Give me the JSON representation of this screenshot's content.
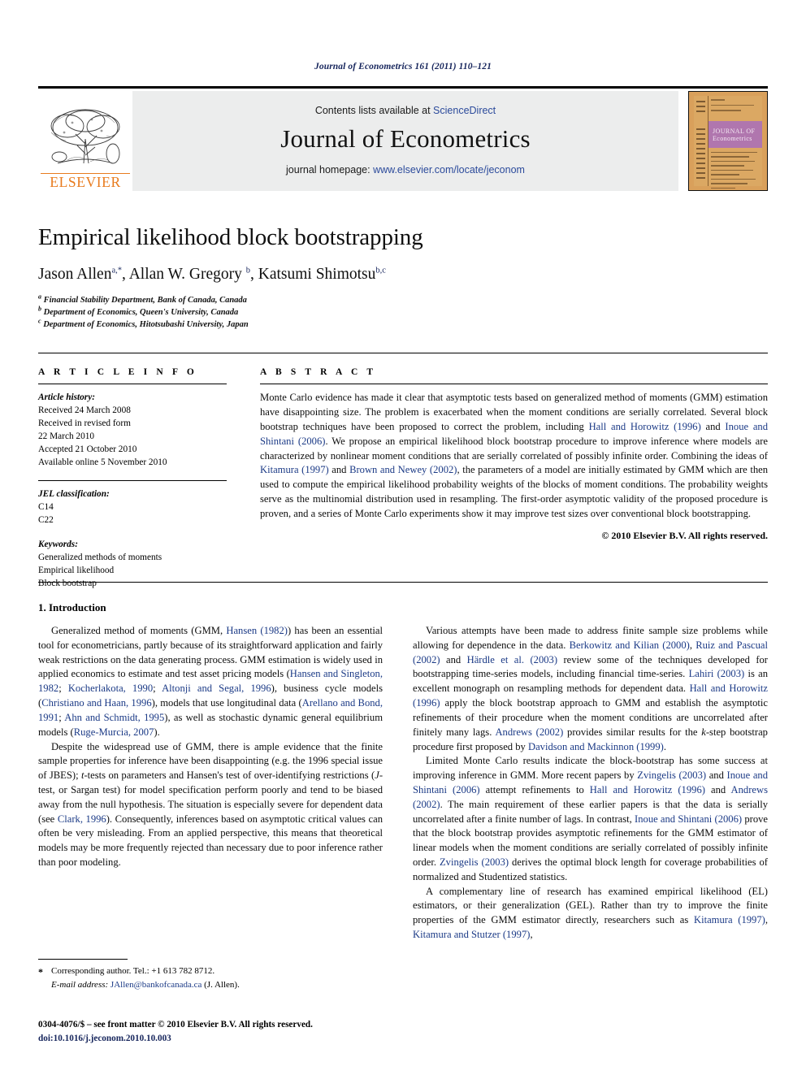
{
  "running_head": "Journal of Econometrics 161 (2011) 110–121",
  "masthead": {
    "publisher_name": "ELSEVIER",
    "contents_prefix": "Contents lists available at ",
    "contents_link": "ScienceDirect",
    "journal_title": "Journal of Econometrics",
    "homepage_prefix": "journal homepage: ",
    "homepage_link": "www.elsevier.com/locate/jeconom",
    "cover_title_line1": "JOURNAL OF",
    "cover_title_line2": "Econometrics",
    "link_color": "#2b4a9b",
    "brand_color": "#e87b1e"
  },
  "article": {
    "title": "Empirical likelihood block bootstrapping",
    "authors_html": "Jason Allen<sup>a,*</sup>, Allan W. Gregory <sup>b</sup>, Katsumi Shimotsu<sup>b,c</sup>",
    "affiliations": [
      {
        "marker": "a",
        "text": "Financial Stability Department, Bank of Canada, Canada"
      },
      {
        "marker": "b",
        "text": "Department of Economics, Queen's University, Canada"
      },
      {
        "marker": "c",
        "text": "Department of Economics, Hitotsubashi University, Japan"
      }
    ]
  },
  "article_info": {
    "label": "A R T I C L E   I N F O",
    "history_head": "Article history:",
    "history_lines": [
      "Received 24 March 2008",
      "Received in revised form",
      "22 March 2010",
      "Accepted 21 October 2010",
      "Available online 5 November 2010"
    ],
    "jel_head": "JEL classification:",
    "jel_codes": [
      "C14",
      "C22"
    ],
    "keywords_head": "Keywords:",
    "keywords": [
      "Generalized methods of moments",
      "Empirical likelihood",
      "Block bootstrap"
    ]
  },
  "abstract": {
    "label": "A B S T R A C T",
    "text_html": "Monte Carlo evidence has made it clear that asymptotic tests based on generalized method of moments (GMM) estimation have disappointing size. The problem is exacerbated when the moment conditions are serially correlated. Several block bootstrap techniques have been proposed to correct the problem, including <span class=\"cite\">Hall and Horowitz (1996)</span> and <span class=\"cite\">Inoue and Shintani (2006)</span>. We propose an empirical likelihood block bootstrap procedure to improve inference where models are characterized by nonlinear moment conditions that are serially correlated of possibly infinite order. Combining the ideas of <span class=\"cite\">Kitamura (1997)</span> and <span class=\"cite\">Brown and Newey (2002)</span>, the parameters of a model are initially estimated by GMM which are then used to compute the empirical likelihood probability weights of the blocks of moment conditions. The probability weights serve as the multinomial distribution used in resampling. The first-order asymptotic validity of the proposed procedure is proven, and a series of Monte Carlo experiments show it may improve test sizes over conventional block bootstrapping.",
    "copyright": "© 2010 Elsevier B.V. All rights reserved."
  },
  "body": {
    "section_heading": "1. Introduction",
    "left_paragraphs_html": [
      "Generalized method of moments (GMM, <span class=\"cite\">Hansen (1982)</span>) has been an essential tool for econometricians, partly because of its straightforward application and fairly weak restrictions on the data generating process. GMM estimation is widely used in applied economics to estimate and test asset pricing models (<span class=\"cite\">Hansen and Singleton, 1982</span>; <span class=\"cite\">Kocherlakota, 1990</span>; <span class=\"cite\">Altonji and Segal, 1996</span>), business cycle models (<span class=\"cite\">Christiano and Haan, 1996</span>), models that use longitudinal data (<span class=\"cite\">Arellano and Bond, 1991</span>; <span class=\"cite\">Ahn and Schmidt, 1995</span>), as well as stochastic dynamic general equilibrium models (<span class=\"cite\">Ruge-Murcia, 2007</span>).",
      "Despite the widespread use of GMM, there is ample evidence that the finite sample properties for inference have been disappointing (e.g. the 1996 special issue of JBES); <i>t</i>-tests on parameters and Hansen's test of over-identifying restrictions (<i>J</i>-test, or Sargan test) for model specification perform poorly and tend to be biased away from the null hypothesis. The situation is especially severe for dependent data (see <span class=\"cite\">Clark, 1996</span>). Consequently, inferences based on asymptotic critical values can often be very misleading. From an applied perspective, this means that theoretical models may be more frequently rejected than necessary due to poor inference rather than poor modeling."
    ],
    "right_paragraphs_html": [
      "Various attempts have been made to address finite sample size problems while allowing for dependence in the data. <span class=\"cite\">Berkowitz and Kilian (2000)</span>, <span class=\"cite\">Ruiz and Pascual (2002)</span> and <span class=\"cite\">Härdle et al. (2003)</span> review some of the techniques developed for bootstrapping time-series models, including financial time-series. <span class=\"cite\">Lahiri (2003)</span> is an excellent monograph on resampling methods for dependent data. <span class=\"cite\">Hall and Horowitz (1996)</span> apply the block bootstrap approach to GMM and establish the asymptotic refinements of their procedure when the moment conditions are uncorrelated after finitely many lags. <span class=\"cite\">Andrews (2002)</span> provides similar results for the <i>k</i>-step bootstrap procedure first proposed by <span class=\"cite\">Davidson and Mackinnon (1999)</span>.",
      "Limited Monte Carlo results indicate the block-bootstrap has some success at improving inference in GMM. More recent papers by <span class=\"cite\">Zvingelis (2003)</span> and <span class=\"cite\">Inoue and Shintani (2006)</span> attempt refinements to <span class=\"cite\">Hall and Horowitz (1996)</span> and <span class=\"cite\">Andrews (2002)</span>. The main requirement of these earlier papers is that the data is serially uncorrelated after a finite number of lags. In contrast, <span class=\"cite\">Inoue and Shintani (2006)</span> prove that the block bootstrap provides asymptotic refinements for the GMM estimator of linear models when the moment conditions are serially correlated of possibly infinite order. <span class=\"cite\">Zvingelis (2003)</span> derives the optimal block length for coverage probabilities of normalized and Studentized statistics.",
      "A complementary line of research has examined empirical likelihood (EL) estimators, or their generalization (GEL). Rather than try to improve the finite properties of the GMM estimator directly, researchers such as <span class=\"cite\">Kitamura (1997)</span>, <span class=\"cite\">Kitamura and Stutzer (1997)</span>,"
    ]
  },
  "footnote": {
    "corresponding_marker": "*",
    "corresponding_text": "Corresponding author. Tel.: +1 613 782 8712.",
    "email_label": "E-mail address:",
    "email_link": "JAllen@bankofcanada.ca",
    "email_suffix": " (J. Allen)."
  },
  "imprint": {
    "issn_line": "0304-4076/$ – see front matter © 2010 Elsevier B.V. All rights reserved.",
    "doi_line": "doi:10.1016/j.jeconom.2010.10.003"
  }
}
